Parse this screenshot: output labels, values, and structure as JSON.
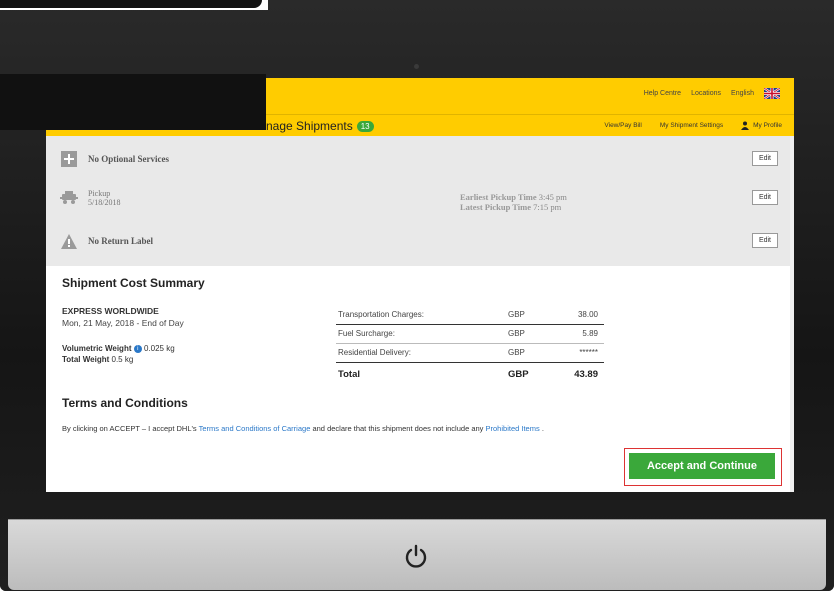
{
  "header": {
    "links": [
      "Help Centre",
      "Locations",
      "English"
    ],
    "flag_icon": "uk-flag-icon",
    "brand_color": "#ffcc00"
  },
  "subheader": {
    "title": "nage Shipments",
    "count": "13",
    "links": [
      "View/Pay Bill",
      "My Shipment Settings",
      "My Profile"
    ]
  },
  "options": {
    "optional_services": "No Optional Services",
    "pickup_label": "Pickup",
    "pickup_date": "5/18/2018",
    "earliest_label": "Earliest Pickup Time",
    "earliest_time": "3:45 pm",
    "latest_label": "Latest Pickup Time",
    "latest_time": "7:15 pm",
    "return_label": "No Return Label",
    "edit": "Edit"
  },
  "summary": {
    "title": "Shipment Cost Summary",
    "service": "EXPRESS WORLDWIDE",
    "date": "Mon, 21 May, 2018 - End of Day",
    "volumetric_label": "Volumetric Weight",
    "volumetric_value": "0.025 kg",
    "total_weight_label": "Total Weight",
    "total_weight_value": "0.5 kg",
    "charges": [
      {
        "label": "Transportation Charges:",
        "currency": "GBP",
        "amount": "38.00"
      },
      {
        "label": "Fuel Surcharge:",
        "currency": "GBP",
        "amount": "5.89"
      },
      {
        "label": "Residential Delivery:",
        "currency": "GBP",
        "amount": "******"
      }
    ],
    "total": {
      "label": "Total",
      "currency": "GBP",
      "amount": "43.89"
    }
  },
  "terms": {
    "title": "Terms and Conditions",
    "prefix": "By clicking on ACCEPT – I accept DHL's",
    "link1": "Terms and Conditions of Carriage",
    "middle": "and declare that this shipment does not include any",
    "link2": "Prohibited Items",
    "suffix": "."
  },
  "actions": {
    "accept": "Accept and Continue",
    "accept_color": "#3aa83a"
  }
}
